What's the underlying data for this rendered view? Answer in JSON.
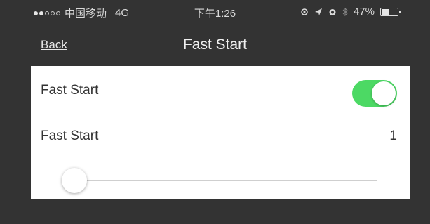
{
  "status_bar": {
    "carrier": "中国移动",
    "network": "4G",
    "time": "下午1:26",
    "battery_percent": "47%",
    "battery_level": 0.47
  },
  "nav": {
    "back_label": "Back",
    "title": "Fast Start"
  },
  "settings": {
    "toggle_row": {
      "label": "Fast Start",
      "on": true,
      "accent_color": "#4cd964"
    },
    "value_row": {
      "label": "Fast Start",
      "value": "1"
    },
    "slider": {
      "value_fraction": 0
    }
  }
}
